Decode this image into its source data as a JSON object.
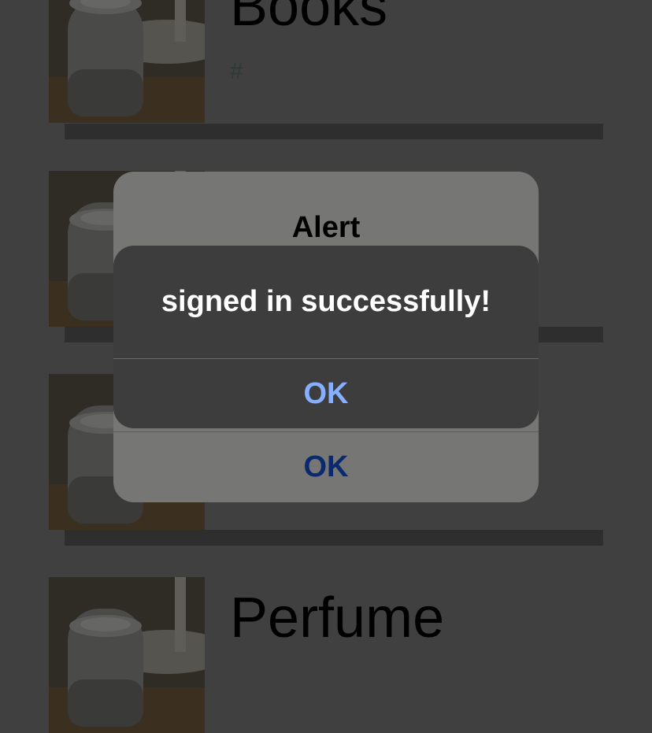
{
  "list": {
    "items": [
      {
        "title": "Books",
        "subtitle": "#",
        "image": "smart-speaker-photo"
      },
      {
        "title": "",
        "subtitle": "",
        "image": "smart-speaker-photo"
      },
      {
        "title": "",
        "subtitle": "",
        "image": "smart-speaker-photo"
      },
      {
        "title": "Perfume",
        "subtitle": "",
        "image": "smart-speaker-photo"
      }
    ]
  },
  "alert_back": {
    "title": "Alert",
    "ok_label": "OK"
  },
  "alert_front": {
    "message": "signed in successfully!",
    "ok_label": "OK"
  },
  "colors": {
    "overlay_background": "#404040",
    "ok_light_blue": "#86b0ff",
    "ok_dark_blue": "#0b2a6e"
  }
}
